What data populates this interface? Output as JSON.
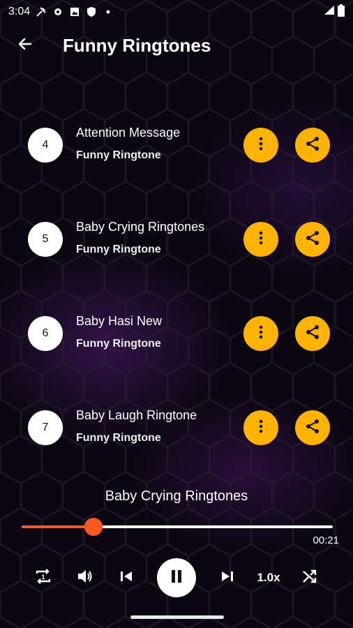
{
  "status_bar": {
    "time": "3:04",
    "icons": [
      "tools-icon",
      "settings-icon",
      "image-icon",
      "shield-icon",
      "dot-icon"
    ],
    "right_icons": [
      "wifi-icon",
      "battery-icon"
    ]
  },
  "app_bar": {
    "title": "Funny Ringtones",
    "back_icon": "arrow-left-icon"
  },
  "ringtones": [
    {
      "number": "4",
      "title": "Attention Message",
      "subtitle": "Funny Ringtone"
    },
    {
      "number": "5",
      "title": "Baby Crying Ringtones",
      "subtitle": "Funny Ringtone"
    },
    {
      "number": "6",
      "title": "Baby Hasi New",
      "subtitle": "Funny Ringtone"
    },
    {
      "number": "7",
      "title": "Baby Laugh Ringtone",
      "subtitle": "Funny Ringtone"
    }
  ],
  "player": {
    "now_playing": "Baby Crying Ringtones",
    "elapsed": "00:21",
    "progress_fraction": 0.23,
    "speed": "1.0x",
    "icons": [
      "repeat-one-icon",
      "volume-icon",
      "skip-previous-icon",
      "pause-icon",
      "skip-next-icon",
      "shuffle-icon"
    ]
  },
  "colors": {
    "accent": "#ffb300",
    "progress": "#ff5722",
    "background": "#0b0712"
  }
}
